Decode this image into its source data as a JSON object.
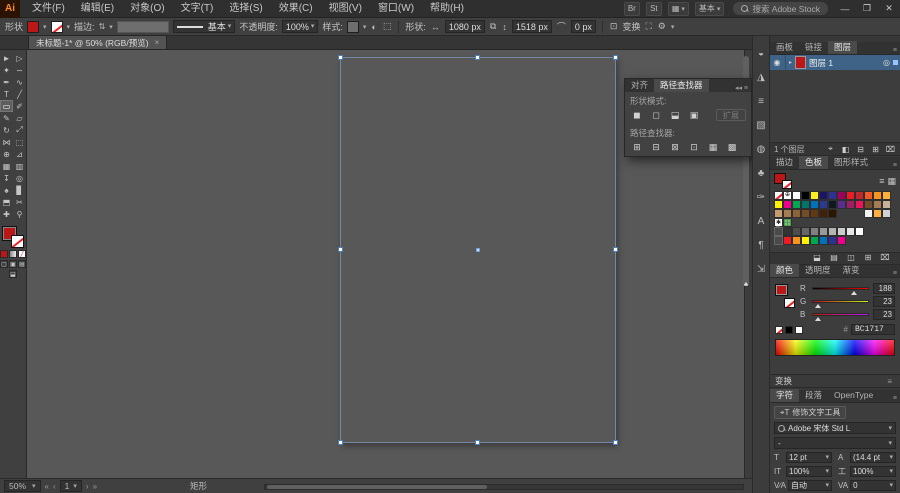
{
  "window": {
    "logo": "Ai",
    "workspace_label": "基本",
    "search_placeholder": "搜索 Adobe Stock",
    "minimize": "—",
    "maximize": "❐",
    "close": "✕"
  },
  "menubar": {
    "items": [
      {
        "label": "文件(F)"
      },
      {
        "label": "编辑(E)"
      },
      {
        "label": "对象(O)"
      },
      {
        "label": "文字(T)"
      },
      {
        "label": "选择(S)"
      },
      {
        "label": "效果(C)"
      },
      {
        "label": "视图(V)"
      },
      {
        "label": "窗口(W)"
      },
      {
        "label": "帮助(H)"
      }
    ],
    "title_icons": [
      {
        "glyph": "Br",
        "name": "bridge-icon"
      },
      {
        "glyph": "St",
        "name": "stock-icon"
      }
    ],
    "arrange_glyph": "▦"
  },
  "controlbar": {
    "selection_label": "形状",
    "stroke_label": "描边:",
    "brush_label": "基本",
    "opacity_label": "不透明度:",
    "opacity_value": "100%",
    "style_label": "样式:",
    "shape_label": "形状:",
    "width_value": "1080 px",
    "height_value": "1518 px",
    "corner_value": "0 px",
    "transform_label": "变换"
  },
  "tabbar": {
    "doc_title": "未标题-1* @ 50% (RGB/预览)",
    "close": "×"
  },
  "toolbar": {
    "tools": [
      {
        "glyph": "►",
        "name": "selection-tool"
      },
      {
        "glyph": "▷",
        "name": "direct-selection-tool"
      },
      {
        "glyph": "✦",
        "name": "magic-wand-tool"
      },
      {
        "glyph": "∽",
        "name": "lasso-tool"
      },
      {
        "glyph": "✒",
        "name": "pen-tool"
      },
      {
        "glyph": "∿",
        "name": "curvature-tool"
      },
      {
        "glyph": "T",
        "name": "type-tool"
      },
      {
        "glyph": "╱",
        "name": "line-segment-tool"
      },
      {
        "glyph": "▭",
        "name": "rectangle-tool",
        "selected": true
      },
      {
        "glyph": "✐",
        "name": "paintbrush-tool"
      },
      {
        "glyph": "✎",
        "name": "pencil-tool"
      },
      {
        "glyph": "▱",
        "name": "shaper-tool"
      },
      {
        "glyph": "↻",
        "name": "rotate-tool"
      },
      {
        "glyph": "⤢",
        "name": "scale-tool"
      },
      {
        "glyph": "⋈",
        "name": "width-tool"
      },
      {
        "glyph": "⬚",
        "name": "free-transform-tool"
      },
      {
        "glyph": "⊕",
        "name": "shape-builder-tool"
      },
      {
        "glyph": "⊿",
        "name": "perspective-grid-tool"
      },
      {
        "glyph": "▦",
        "name": "mesh-tool"
      },
      {
        "glyph": "▥",
        "name": "gradient-tool"
      },
      {
        "glyph": "↧",
        "name": "eyedropper-tool"
      },
      {
        "glyph": "◎",
        "name": "blend-tool"
      },
      {
        "glyph": "♠",
        "name": "symbol-sprayer-tool"
      },
      {
        "glyph": "▊",
        "name": "column-graph-tool"
      },
      {
        "glyph": "⬒",
        "name": "artboard-tool"
      },
      {
        "glyph": "✂",
        "name": "slice-tool"
      },
      {
        "glyph": "✚",
        "name": "hand-tool"
      },
      {
        "glyph": "⚲",
        "name": "zoom-tool"
      }
    ]
  },
  "canvas": {
    "artboard_fill": "#bc1717"
  },
  "pathfinder_panel": {
    "tabs": [
      {
        "label": "对齐"
      },
      {
        "label": "路径查找器",
        "active": true
      }
    ],
    "shape_modes_label": "形状模式:",
    "pathfinders_label": "路径查找器:",
    "expand_label": "扩展",
    "shape_mode_icons": [
      {
        "glyph": "◼",
        "name": "unite-icon"
      },
      {
        "glyph": "◻",
        "name": "minus-front-icon"
      },
      {
        "glyph": "⬓",
        "name": "intersect-icon"
      },
      {
        "glyph": "▣",
        "name": "exclude-icon"
      }
    ],
    "pathfinder_icons": [
      {
        "glyph": "⊞",
        "name": "divide-icon"
      },
      {
        "glyph": "⊟",
        "name": "trim-icon"
      },
      {
        "glyph": "⊠",
        "name": "merge-icon"
      },
      {
        "glyph": "⊡",
        "name": "crop-icon"
      },
      {
        "glyph": "▦",
        "name": "outline-icon"
      },
      {
        "glyph": "▩",
        "name": "minus-back-icon"
      }
    ]
  },
  "dock_strip": {
    "icons": [
      {
        "glyph": "◒",
        "name": "color-panel-icon"
      },
      {
        "glyph": "◮",
        "name": "color-guide-panel-icon"
      },
      {
        "glyph": "≡",
        "name": "stroke-panel-icon"
      },
      {
        "glyph": "▧",
        "name": "gradient-panel-icon"
      },
      {
        "glyph": "◍",
        "name": "transparency-panel-icon"
      },
      {
        "glyph": "♣",
        "name": "symbols-panel-icon"
      },
      {
        "glyph": "✑",
        "name": "brushes-panel-icon"
      },
      {
        "glyph": "A",
        "name": "character-styles-panel-icon"
      },
      {
        "glyph": "¶",
        "name": "paragraph-styles-panel-icon"
      },
      {
        "glyph": "⇲",
        "name": "export-panel-icon"
      }
    ]
  },
  "layers_panel": {
    "tabs": [
      {
        "label": "画板"
      },
      {
        "label": "链接"
      },
      {
        "label": "图层",
        "active": true
      }
    ],
    "eye_glyph": "◉",
    "expand_glyph": "▸",
    "layer_name": "图层 1",
    "target_glyph": "◎",
    "count_label": "1 个图层",
    "footer_icons": [
      {
        "glyph": "⌖",
        "name": "locate-object-icon"
      },
      {
        "glyph": "◧",
        "name": "clipping-mask-icon"
      },
      {
        "glyph": "⊟",
        "name": "new-sublayer-icon"
      },
      {
        "glyph": "⊞",
        "name": "new-layer-icon"
      },
      {
        "glyph": "⌧",
        "name": "delete-layer-icon"
      }
    ]
  },
  "swatches_panel": {
    "tabs": [
      {
        "label": "描边"
      },
      {
        "label": "色板",
        "active": true
      },
      {
        "label": "图形样式"
      }
    ],
    "list_view_glyph": "≡",
    "grid_view_glyph": "▦",
    "rows": [
      [
        "none",
        "reg",
        "#ffffff",
        "#000000",
        "#fcee21",
        "#1b1464",
        "#2e3192",
        "#9e005d",
        "#ed1c24",
        "#c1272d",
        "#f15a24",
        "#f7931e",
        "#fbb03b"
      ],
      [
        "#fff200",
        "#ec008c",
        "#00a651",
        "#00736a",
        "#0072bc",
        "#2b3990",
        "#101820",
        "#5c2d91",
        "#9e1f63",
        "#ed145b",
        "#754c29",
        "#a67c52",
        "#c7b299"
      ],
      [
        "#c69c6d",
        "#a67c52",
        "#8c6239",
        "#754c24",
        "#603913",
        "#42210b",
        "#2b1700",
        "",
        "",
        "",
        "#f2f2f2",
        "#fbb040",
        "#d1d3d4"
      ],
      [
        "pattern-star",
        "pattern-grid"
      ],
      [
        "folder",
        "#333333",
        "#4d4d4d",
        "#666666",
        "#808080",
        "#999999",
        "#b3b3b3",
        "#cccccc",
        "#e6e6e6",
        "#ffffff"
      ],
      [
        "folder",
        "#ed1c24",
        "#f7941d",
        "#fff200",
        "#00a651",
        "#0072bc",
        "#2e3192",
        "#ec008c"
      ]
    ],
    "footer_icons": [
      {
        "glyph": "⬓",
        "name": "swatch-libraries-icon"
      },
      {
        "glyph": "▤",
        "name": "swatch-kinds-icon"
      },
      {
        "glyph": "◫",
        "name": "new-color-group-icon"
      },
      {
        "glyph": "⊞",
        "name": "new-swatch-icon"
      },
      {
        "glyph": "⌧",
        "name": "delete-swatch-icon"
      }
    ]
  },
  "color_panel": {
    "tabs": [
      {
        "label": "颜色",
        "active": true
      },
      {
        "label": "透明度"
      },
      {
        "label": "渐变"
      }
    ],
    "sliders": [
      {
        "label": "R",
        "value": "188"
      },
      {
        "label": "G",
        "value": "23"
      },
      {
        "label": "B",
        "value": "23"
      }
    ],
    "hex_label": "#",
    "hex": "BC1717",
    "current_color": "#bc1717"
  },
  "transform_bar": {
    "label": "变换"
  },
  "character_panel": {
    "tabs": [
      {
        "label": "字符",
        "active": true
      },
      {
        "label": "段落"
      },
      {
        "label": "OpenType"
      }
    ],
    "touch_icon": "⌖T",
    "touch_label": "修饰文字工具",
    "font_name": "Adobe 宋体 Std L",
    "font_style": "-",
    "size_icon": "T",
    "size_value": "12 pt",
    "leading_icon": "A",
    "leading_value": "(14.4 pt",
    "vscale_icon": "IT",
    "vscale_value": "100%",
    "hscale_icon": "工",
    "hscale_value": "100%",
    "kerning_icon": "V∕A",
    "kerning_value": "自动",
    "tracking_icon": "VA",
    "tracking_value": "0"
  },
  "statusbar": {
    "zoom_value": "50%",
    "first": "«",
    "prev": "‹",
    "artboard_value": "1",
    "next": "›",
    "last": "»",
    "tool_label": "矩形"
  }
}
